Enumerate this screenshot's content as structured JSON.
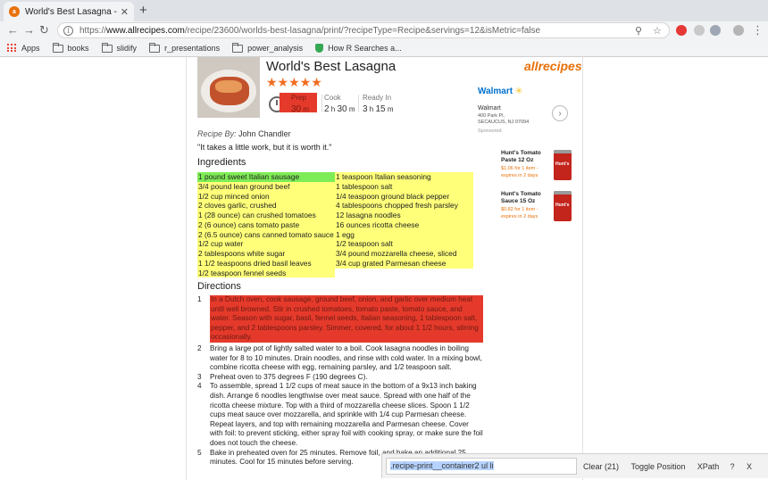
{
  "browser": {
    "tab_title": "World's Best Lasagna - Printer",
    "favicon": "allrecipes-favicon",
    "url_scheme": "https://",
    "url_host": "www.allrecipes.com",
    "url_path": "/recipe/23600/worlds-best-lasagna/print/?recipeType=Recipe&servings=12&isMetric=false",
    "bookmarks": [
      {
        "label": "Apps",
        "icon": "apps-grid-icon"
      },
      {
        "label": "books",
        "icon": "folder-icon"
      },
      {
        "label": "slidify",
        "icon": "folder-icon"
      },
      {
        "label": "r_presentations",
        "icon": "folder-icon"
      },
      {
        "label": "power_analysis",
        "icon": "folder-icon"
      },
      {
        "label": "How R Searches a...",
        "icon": "bookmark-favicon-icon"
      }
    ]
  },
  "recipe": {
    "title": "World's Best Lasagna",
    "stars": "★★★★★",
    "logo": "allrecipes",
    "times": {
      "prep_label": "Prep",
      "prep_value": "30",
      "prep_unit": "m",
      "cook_label": "Cook",
      "cook_h": "2",
      "cook_m": "30",
      "ready_label": "Ready In",
      "ready_h": "3",
      "ready_m": "15",
      "h_unit": "h",
      "m_unit": "m"
    },
    "recipe_by_label": "Recipe By:",
    "author": "John Chandler",
    "quote": "\"It takes a little work, but it is worth it.\"",
    "ingredients_heading": "Ingredients",
    "ingredients_left": [
      "1 pound sweet Italian sausage",
      "3/4 pound lean ground beef",
      "1/2 cup minced onion",
      "2 cloves garlic, crushed",
      "1 (28 ounce) can crushed tomatoes",
      "2 (6 ounce) cans tomato paste",
      "2 (6.5 ounce) cans canned tomato sauce",
      "1/2 cup water",
      "2 tablespoons white sugar",
      "1 1/2 teaspoons dried basil leaves",
      "1/2 teaspoon fennel seeds"
    ],
    "ingredients_right": [
      "1 teaspoon Italian seasoning",
      "1 tablespoon salt",
      "1/4 teaspoon ground black pepper",
      "4 tablespoons chopped fresh parsley",
      "12 lasagna noodles",
      "16 ounces ricotta cheese",
      "1 egg",
      "1/2 teaspoon salt",
      "3/4 pound mozzarella cheese, sliced",
      "3/4 cup grated Parmesan cheese"
    ],
    "directions_heading": "Directions",
    "directions": [
      {
        "num": "1",
        "text": "In a Dutch oven, cook sausage, ground beef, onion, and garlic over medium heat until well browned. Stir in crushed tomatoes, tomato paste, tomato sauce, and water. Season with sugar, basil, fennel seeds, Italian seasoning, 1 tablespoon salt, pepper, and 2 tablespoons parsley. Simmer, covered, for about 1 1/2 hours, stirring occasionally."
      },
      {
        "num": "2",
        "text": "Bring a large pot of lightly salted water to a boil. Cook lasagna noodles in boiling water for 8 to 10 minutes. Drain noodles, and rinse with cold water. In a mixing bowl, combine ricotta cheese with egg, remaining parsley, and 1/2 teaspoon salt."
      },
      {
        "num": "3",
        "text": "Preheat oven to 375 degrees F (190 degrees C)."
      },
      {
        "num": "4",
        "text": "To assemble, spread 1 1/2 cups of meat sauce in the bottom of a 9x13 inch baking dish. Arrange 6 noodles lengthwise over meat sauce. Spread with one half of the ricotta cheese mixture. Top with a third of mozzarella cheese slices. Spoon 1 1/2 cups meat sauce over mozzarella, and sprinkle with 1/4 cup Parmesan cheese. Repeat layers, and top with remaining mozzarella and Parmesan cheese. Cover with foil: to prevent sticking, either spray foil with cooking spray, or make sure the foil does not touch the cheese."
      },
      {
        "num": "5",
        "text": "Bake in preheated oven for 25 minutes. Remove foil, and bake an additional 25 minutes. Cool for 15 minutes before serving."
      }
    ]
  },
  "sidebar": {
    "walmart_logo": "Walmart",
    "walmart_spark": "✳",
    "store_name": "Walmart",
    "store_addr1": "400 Park Pl,",
    "store_addr2": "SECAUCUS, NJ 07094",
    "sponsored": "Sponsored",
    "products": [
      {
        "name": "Hunt's Tomato Paste 12 Oz",
        "price": "$1.06 for 1 item - expires in 2 days",
        "can_label": "Hunt's"
      },
      {
        "name": "Hunt's Tomato Sauce 15 Oz",
        "price": "$0.82 for 1 item - expires in 2 days",
        "can_label": "Hunt's"
      }
    ]
  },
  "selector_bar": {
    "selector": ".recipe-print__container2 ul li",
    "clear_label": "Clear (21)",
    "toggle_label": "Toggle Position",
    "xpath_label": "XPath",
    "help_label": "?",
    "close_label": "X"
  },
  "colors": {
    "highlight_green": "#7eec56",
    "highlight_yellow": "#ffff7a",
    "highlight_red": "#e53a2b",
    "allrecipes_orange": "#e8710a",
    "walmart_blue": "#0071ce"
  }
}
